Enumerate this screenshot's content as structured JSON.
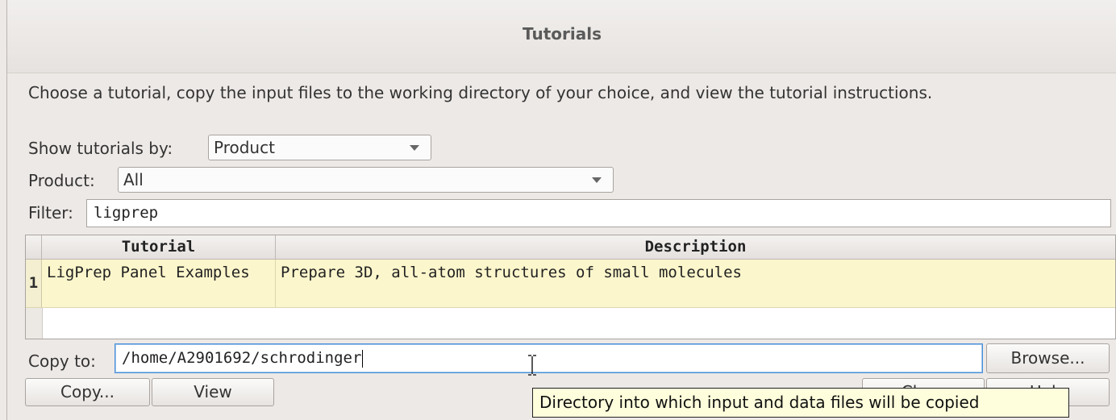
{
  "window": {
    "title": "Tutorials"
  },
  "intro_text": "Choose a tutorial, copy the input files to the working directory of your choice, and view the tutorial instructions.",
  "show_by": {
    "label": "Show tutorials by:",
    "selected": "Product"
  },
  "product": {
    "label": "Product:",
    "selected": "All"
  },
  "filter": {
    "label": "Filter:",
    "value": "ligprep"
  },
  "table": {
    "columns": [
      "Tutorial",
      "Description"
    ],
    "rows": [
      {
        "num": "1",
        "tutorial": "LigPrep Panel Examples",
        "description": "Prepare 3D, all-atom structures of small molecules"
      }
    ]
  },
  "copy_to": {
    "label": "Copy to:",
    "value": "/home/A2901692/schrodinger",
    "browse_label": "Browse..."
  },
  "buttons": {
    "copy": "Copy...",
    "view": "View",
    "close_partial": "Close",
    "help_partial": "Help"
  },
  "tooltip": "Directory into which input and data files will be copied"
}
